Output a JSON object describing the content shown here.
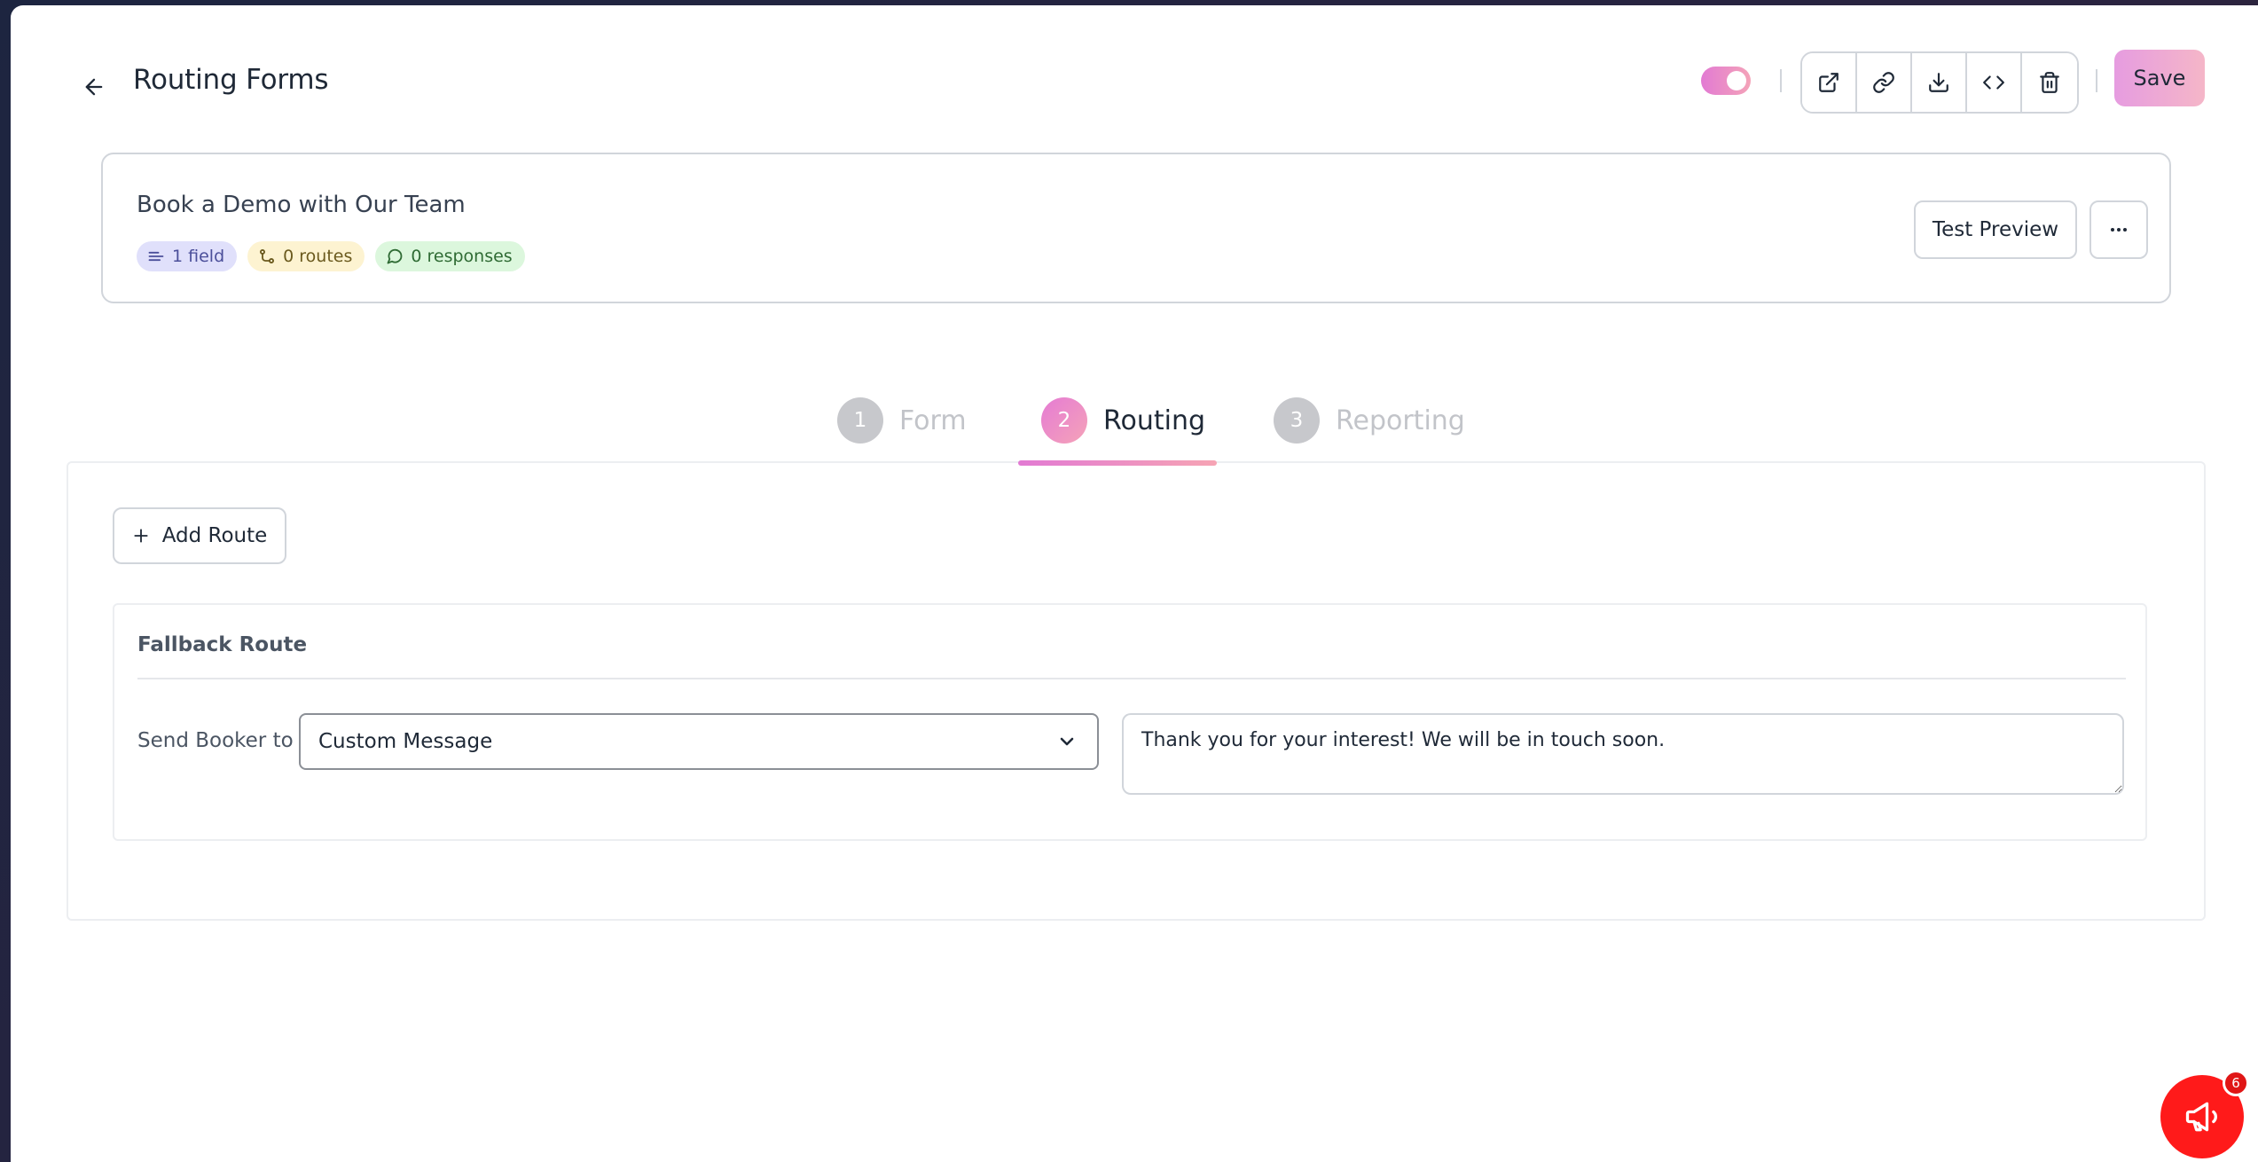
{
  "header": {
    "title": "Routing Forms",
    "save_label": "Save",
    "toggle_on": true,
    "icons": [
      "back-arrow-icon",
      "external-link-icon",
      "link-icon",
      "download-icon",
      "code-icon",
      "trash-icon"
    ]
  },
  "form": {
    "name": "Book a Demo with Our Team",
    "badges": {
      "fields": "1 field",
      "routes": "0 routes",
      "responses": "0 responses"
    },
    "test_preview_label": "Test Preview"
  },
  "tabs": [
    {
      "number": "1",
      "label": "Form",
      "active": false
    },
    {
      "number": "2",
      "label": "Routing",
      "active": true
    },
    {
      "number": "3",
      "label": "Reporting",
      "active": false
    }
  ],
  "routing": {
    "add_route_label": "Add Route",
    "fallback": {
      "title": "Fallback Route",
      "send_label": "Send Booker to",
      "selected_option": "Custom Message",
      "message": "Thank you for your interest! We will be in touch soon."
    }
  },
  "announcements": {
    "count": "6"
  },
  "colors": {
    "accent_start": "#e27ad3",
    "accent_end": "#f5a3b8",
    "announce_red": "#ff1a1a"
  }
}
